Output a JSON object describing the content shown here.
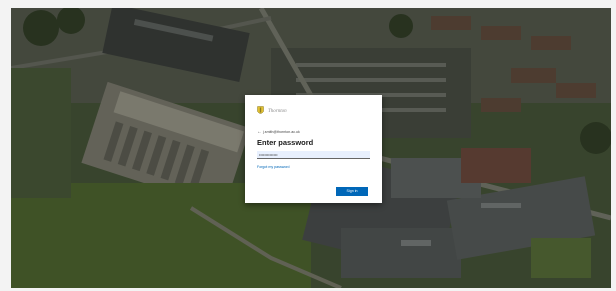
{
  "signin": {
    "logo_text": "Thornton",
    "identity": "j.smith@thornton.ac.uk",
    "title": "Enter password",
    "password_value": "••••••••••••••",
    "password_placeholder": "Password",
    "forgot_link": "Forgot my password",
    "submit_label": "Sign in"
  },
  "colors": {
    "accent": "#0067b8",
    "card_background": "#ffffff",
    "overlay": "#2c3325"
  },
  "icons": {
    "back": "back-arrow-icon",
    "logo": "school-crest-icon"
  }
}
